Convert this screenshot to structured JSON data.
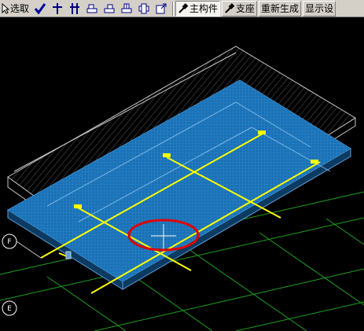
{
  "toolbar": {
    "select_label": "选取",
    "main_member_label": "主构件",
    "support_label": "支座",
    "regenerate_label": "重新生成",
    "display_settings_label": "显示设"
  },
  "viewport": {
    "axis_labels": [
      "F",
      "E"
    ],
    "colors": {
      "background": "#000000",
      "slab_mesh": "#1e7fc8",
      "slab_edge": "#5aa0dc",
      "axis_lines": "#ffff00",
      "grid": "#1fa01f",
      "frame": "#c8c8c8",
      "highlight_ellipse": "#e00000"
    }
  }
}
